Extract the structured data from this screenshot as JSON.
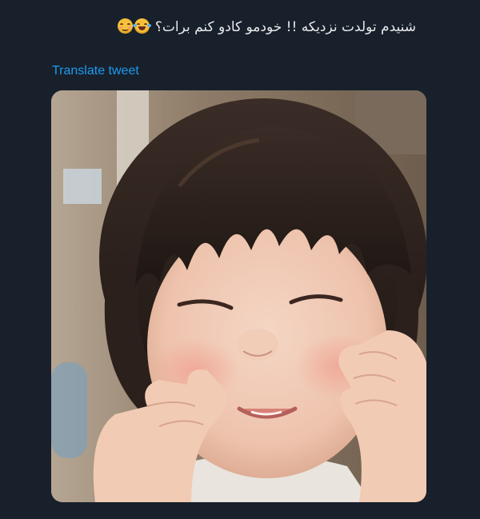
{
  "tweet": {
    "text": "شنیدم تولدت نزدیکه !! خودمو کادو کنم برات؟",
    "emojis": [
      "grinning-squinting-face-emoji",
      "relieved-face-emoji"
    ]
  },
  "translate": {
    "label": "Translate tweet"
  },
  "media": {
    "alt": "photo-of-smiling-toddler-squishing-cheeks"
  },
  "colors": {
    "background": "#18202b",
    "text": "#e7e9ea",
    "link": "#1d9bf0"
  }
}
